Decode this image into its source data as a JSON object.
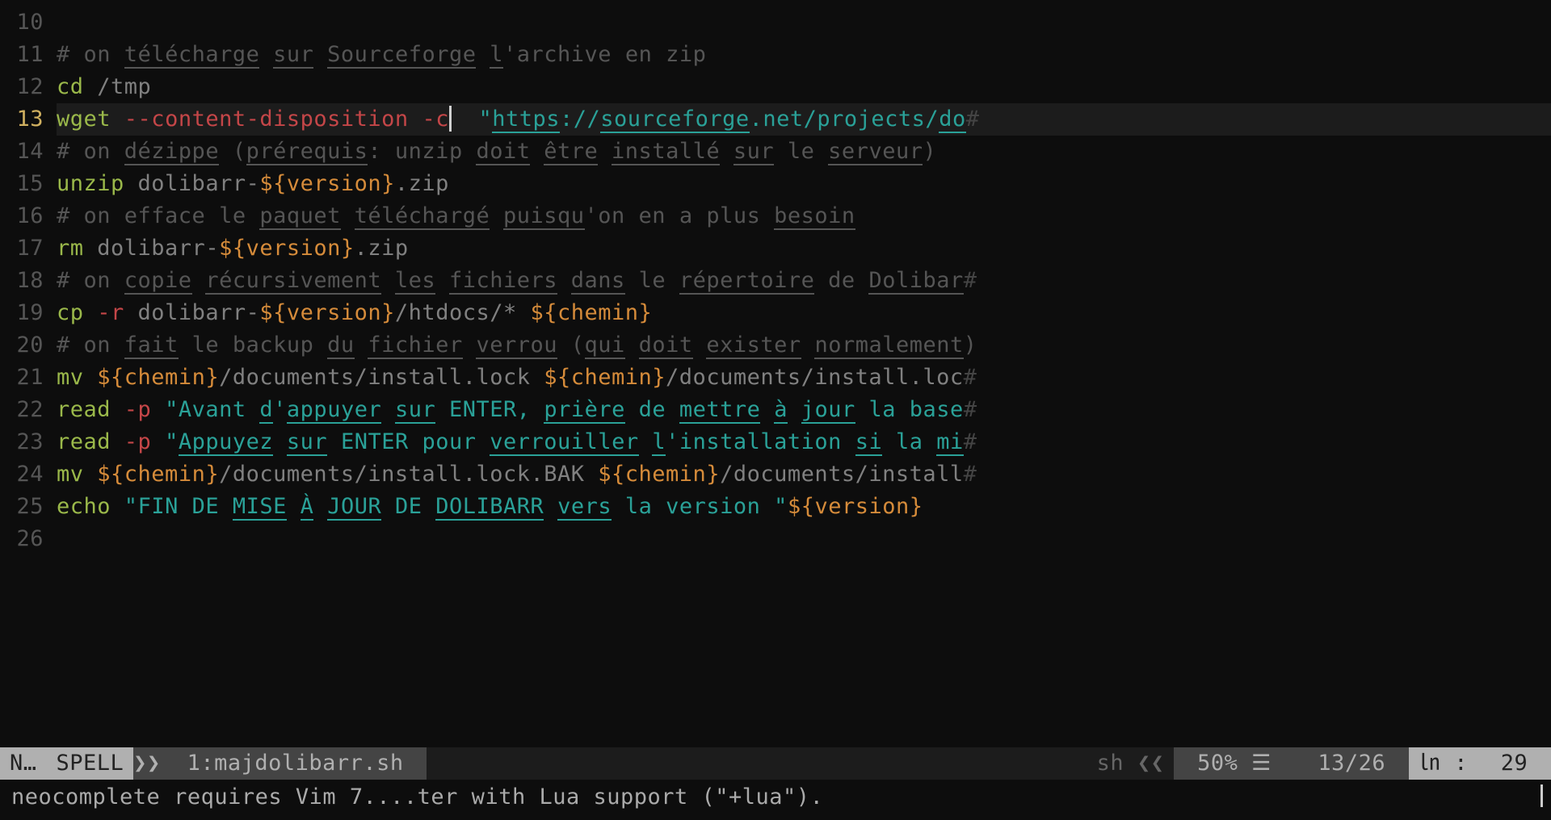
{
  "gutter": {
    "l10": "10",
    "l11": "11",
    "l12": "12",
    "l13": "13",
    "l14": "14",
    "l15": "15",
    "l16": "16",
    "l17": "17",
    "l18": "18",
    "l19": "19",
    "l20": "20",
    "l21": "21",
    "l22": "22",
    "l23": "23",
    "l24": "24",
    "l25": "25",
    "l26": "26"
  },
  "code": {
    "l11": {
      "hash": "# ",
      "on": "on ",
      "w1": "télécharge",
      "sp1": " ",
      "w2": "sur",
      "sp2": " ",
      "w3": "Sourceforge",
      "sp3": " ",
      "w4": "l",
      "ap": "'archive en zip"
    },
    "l12": {
      "cmd": "cd",
      "arg": " /tmp"
    },
    "l13": {
      "cmd": "wget",
      "sp1": " ",
      "opt1": "--content-disposition",
      "sp2": " ",
      "opt2": "-c",
      "sp3": "  ",
      "q": "\"",
      "url1": "https",
      "url2": "://",
      "url3": "sourceforge",
      "url4": ".net/projects/",
      "url5": "do",
      "eol": "#"
    },
    "l14": {
      "hash": "# on ",
      "w1": "dézippe",
      "sp1": " (",
      "w2": "prérequis",
      "sp2": ": unzip ",
      "w3": "doit",
      "sp3": " ",
      "w4": "être",
      "sp4": " ",
      "w5": "installé",
      "sp5": " ",
      "w6": "sur",
      "sp6": " le ",
      "w7": "serveur",
      "end": ")"
    },
    "l15": {
      "cmd": "unzip",
      "a1": " dolibarr-",
      "var": "${version}",
      "a2": ".zip"
    },
    "l16": {
      "hash": "# on efface le ",
      "w1": "paquet",
      "sp1": " ",
      "w2": "téléchargé",
      "sp2": " ",
      "w3": "puisqu",
      "rest": "'on en a plus ",
      "w4": "besoin"
    },
    "l17": {
      "cmd": "rm",
      "a1": " dolibarr-",
      "var": "${version}",
      "a2": ".zip"
    },
    "l18": {
      "hash": "# on ",
      "w1": "copie",
      "sp1": " ",
      "w2": "récursivement",
      "sp2": " ",
      "w3": "les",
      "sp3": " ",
      "w4": "fichiers",
      "sp4": " ",
      "w5": "dans",
      "sp5": " le ",
      "w6": "répertoire",
      "sp6": " de ",
      "w7": "Dolibar",
      "eol": "#"
    },
    "l19": {
      "cmd": "cp",
      "sp1": " ",
      "opt": "-r",
      "a1": " dolibarr-",
      "v1": "${version}",
      "a2": "/htdocs/* ",
      "v2": "${chemin}"
    },
    "l20": {
      "hash": "# on ",
      "w1": "fait",
      "sp1": " le backup ",
      "w2": "du",
      "sp2": " ",
      "w3": "fichier",
      "sp3": " ",
      "w4": "verrou",
      "sp4": " (",
      "w5": "qui",
      "sp5": " ",
      "w6": "doit",
      "sp6": " ",
      "w7": "exister",
      "sp7": " ",
      "w8": "normalement",
      "end": ")"
    },
    "l21": {
      "cmd": "mv",
      "sp1": " ",
      "v1": "${chemin}",
      "a1": "/documents/install.lock ",
      "v2": "${chemin}",
      "a2": "/documents/install.loc",
      "eol": "#"
    },
    "l22": {
      "cmd": "read",
      "sp1": " ",
      "opt": "-p",
      "sp2": " ",
      "q": "\"",
      "s1": "Avant ",
      "w1": "d",
      "ap": "'",
      "w2": "appuyer",
      "sp3": " ",
      "w3": "sur",
      "sp4": " ENTER, ",
      "w4": "prière",
      "sp5": " de ",
      "w5": "mettre",
      "sp6": " ",
      "w6": "à",
      "sp7": " ",
      "w7": "jour",
      "rest": " la base",
      "eol": "#"
    },
    "l23": {
      "cmd": "read",
      "sp1": " ",
      "opt": "-p",
      "sp2": " ",
      "q": "\"",
      "w1": "Appuyez",
      "sp3": " ",
      "w2": "sur",
      "sp4": " ENTER pour ",
      "w3": "verrouiller",
      "sp5": " ",
      "w4": "l",
      "ap": "'installation ",
      "w5": "si",
      "sp6": " la ",
      "w6": "mi",
      "eol": "#"
    },
    "l24": {
      "cmd": "mv",
      "sp1": " ",
      "v1": "${chemin}",
      "a1": "/documents/install.lock.BAK ",
      "v2": "${chemin}",
      "a2": "/documents/install",
      "eol": "#"
    },
    "l25": {
      "cmd": "echo",
      "sp1": " ",
      "q": "\"",
      "s1": "FIN DE ",
      "w1": "MISE",
      "sp2": " ",
      "w2": "À",
      "sp3": " ",
      "w3": "JOUR",
      "sp4": " DE ",
      "w4": "DOLIBARR",
      "sp5": " ",
      "w5": "vers",
      "rest": " la version ",
      "q2": "\"",
      "var": "${version}"
    }
  },
  "status": {
    "mode": "N…",
    "spell": "SPELL",
    "sep1": "❯❯",
    "file": " 1:majdolibarr.sh ",
    "ft": "sh ❮❮",
    "pct": " 50% ☰ ",
    "lines": " 13/26 ",
    "ln": "㏑ :",
    "col": " 29 "
  },
  "message": "neocomplete requires Vim 7....ter with Lua support (\"+lua\")."
}
